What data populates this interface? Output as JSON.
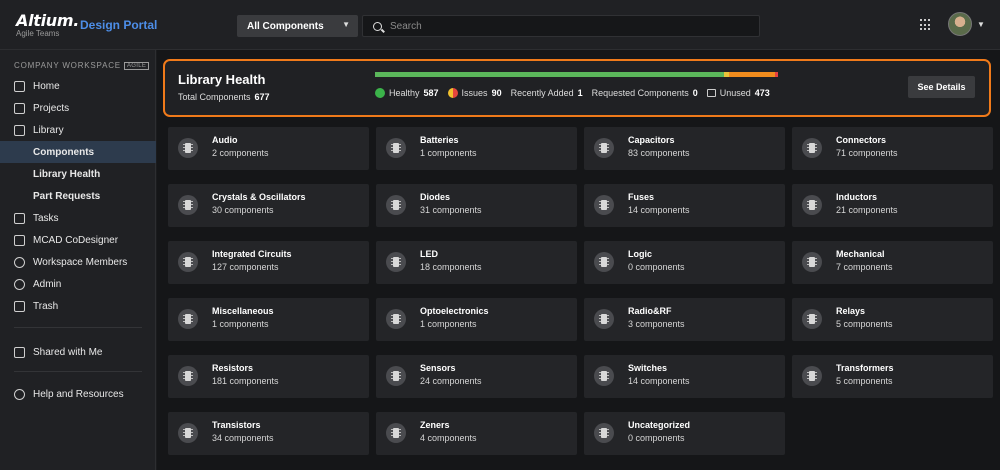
{
  "brand": {
    "logo": "Altium.",
    "tagline": "Agile Teams",
    "portal": "Design Portal"
  },
  "topbar": {
    "scope": "All Components",
    "search_placeholder": "Search"
  },
  "sidebar": {
    "workspace_label": "COMPANY WORKSPACE",
    "workspace_badge": "AGILE",
    "items": [
      {
        "label": "Home",
        "icon": "home-icon"
      },
      {
        "label": "Projects",
        "icon": "folder-icon"
      },
      {
        "label": "Library",
        "icon": "library-icon"
      },
      {
        "label": "Components",
        "sub": true,
        "active": true
      },
      {
        "label": "Library Health",
        "sub": true
      },
      {
        "label": "Part Requests",
        "sub": true
      },
      {
        "label": "Tasks",
        "icon": "tasks-icon"
      },
      {
        "label": "MCAD CoDesigner",
        "icon": "mcad-icon"
      },
      {
        "label": "Workspace Members",
        "icon": "members-icon"
      },
      {
        "label": "Admin",
        "icon": "admin-icon"
      },
      {
        "label": "Trash",
        "icon": "trash-icon"
      },
      {
        "label": "Shared with Me",
        "icon": "share-icon"
      },
      {
        "label": "Help and Resources",
        "icon": "help-icon"
      }
    ]
  },
  "health": {
    "title": "Library Health",
    "total_label": "Total Components",
    "total_value": "677",
    "healthy_label": "Healthy",
    "healthy_value": "587",
    "issues_label": "Issues",
    "issues_value": "90",
    "recent_label": "Recently Added",
    "recent_value": "1",
    "requested_label": "Requested Components",
    "requested_value": "0",
    "unused_label": "Unused",
    "unused_value": "473",
    "see_details": "See Details",
    "bar_fractions": {
      "healthy": 0.865,
      "warn": 0.012,
      "issues": 0.115,
      "end": 0.008
    },
    "colors": {
      "healthy": "#5bb75b",
      "warn": "#e8c33a",
      "issues": "#f08c1e",
      "end": "#e64040",
      "accent": "#f07a1a"
    }
  },
  "categories": [
    {
      "name": "Audio",
      "count": "2 components"
    },
    {
      "name": "Batteries",
      "count": "1 components"
    },
    {
      "name": "Capacitors",
      "count": "83 components"
    },
    {
      "name": "Connectors",
      "count": "71 components"
    },
    {
      "name": "Crystals & Oscillators",
      "count": "30 components"
    },
    {
      "name": "Diodes",
      "count": "31 components"
    },
    {
      "name": "Fuses",
      "count": "14 components"
    },
    {
      "name": "Inductors",
      "count": "21 components"
    },
    {
      "name": "Integrated Circuits",
      "count": "127 components"
    },
    {
      "name": "LED",
      "count": "18 components"
    },
    {
      "name": "Logic",
      "count": "0 components"
    },
    {
      "name": "Mechanical",
      "count": "7 components"
    },
    {
      "name": "Miscellaneous",
      "count": "1 components"
    },
    {
      "name": "Optoelectronics",
      "count": "1 components"
    },
    {
      "name": "Radio&RF",
      "count": "3 components"
    },
    {
      "name": "Relays",
      "count": "5 components"
    },
    {
      "name": "Resistors",
      "count": "181 components"
    },
    {
      "name": "Sensors",
      "count": "24 components"
    },
    {
      "name": "Switches",
      "count": "14 components"
    },
    {
      "name": "Transformers",
      "count": "5 components"
    },
    {
      "name": "Transistors",
      "count": "34 components"
    },
    {
      "name": "Zeners",
      "count": "4 components"
    },
    {
      "name": "Uncategorized",
      "count": "0 components"
    }
  ]
}
